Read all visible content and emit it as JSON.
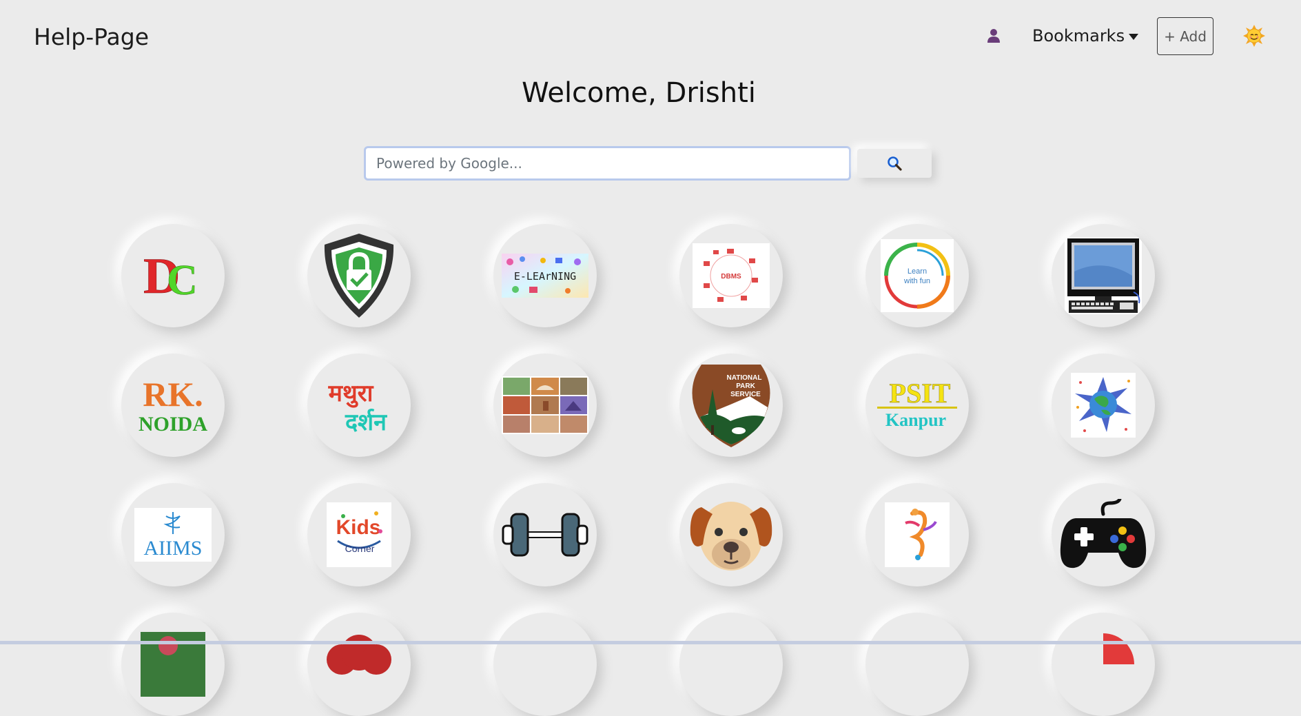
{
  "navbar": {
    "brand": "Help-Page",
    "user_icon": "user-icon",
    "bookmarks_label": "Bookmarks",
    "add_label": "+ Add",
    "theme_icon": "smiley-sun-icon"
  },
  "welcome": "Welcome, Drishti",
  "search": {
    "placeholder": "Powered by Google...",
    "value": "",
    "button_icon": "magnifier-icon"
  },
  "colors": {
    "background": "#ebebeb",
    "search_border": "#b8c9ec",
    "user_icon": "#6a3d7a"
  },
  "tiles": [
    {
      "icon": "dc-logo-icon",
      "text": [
        "D",
        "C"
      ]
    },
    {
      "icon": "security-shield-lock-icon"
    },
    {
      "icon": "e-learning-icon",
      "text": [
        "E-LEArNING"
      ]
    },
    {
      "icon": "dbms-diagram-icon",
      "text": [
        "DBMS"
      ]
    },
    {
      "icon": "learn-with-fun-icon",
      "text": [
        "Learn",
        "with fun"
      ]
    },
    {
      "icon": "desktop-computer-icon"
    },
    {
      "icon": "rk-noida-logo-icon",
      "text": [
        "RK.",
        "NOIDA"
      ]
    },
    {
      "icon": "mathura-darshan-icon",
      "text": [
        "मथुरा",
        "दर्शन"
      ]
    },
    {
      "icon": "india-monuments-collage-icon"
    },
    {
      "icon": "national-park-service-icon",
      "text": [
        "NATIONAL",
        "PARK",
        "SERVICE"
      ]
    },
    {
      "icon": "psit-kanpur-logo-icon",
      "text": [
        "PSIT",
        "Kanpur"
      ]
    },
    {
      "icon": "world-travel-globe-icon"
    },
    {
      "icon": "aiims-logo-icon",
      "text": [
        "AIIMS"
      ]
    },
    {
      "icon": "kids-corner-icon",
      "text": [
        "Kids",
        "Corner"
      ]
    },
    {
      "icon": "dumbbell-icon"
    },
    {
      "icon": "dog-face-icon"
    },
    {
      "icon": "dance-music-icon"
    },
    {
      "icon": "game-controller-icon"
    },
    {
      "icon": "partial-green-photo-icon"
    },
    {
      "icon": "partial-red-cloud-icon"
    },
    {
      "icon": "partial-blank-tile-icon"
    },
    {
      "icon": "partial-blank-tile-icon"
    },
    {
      "icon": "partial-blank-tile-icon"
    },
    {
      "icon": "partial-red-chart-icon"
    }
  ]
}
